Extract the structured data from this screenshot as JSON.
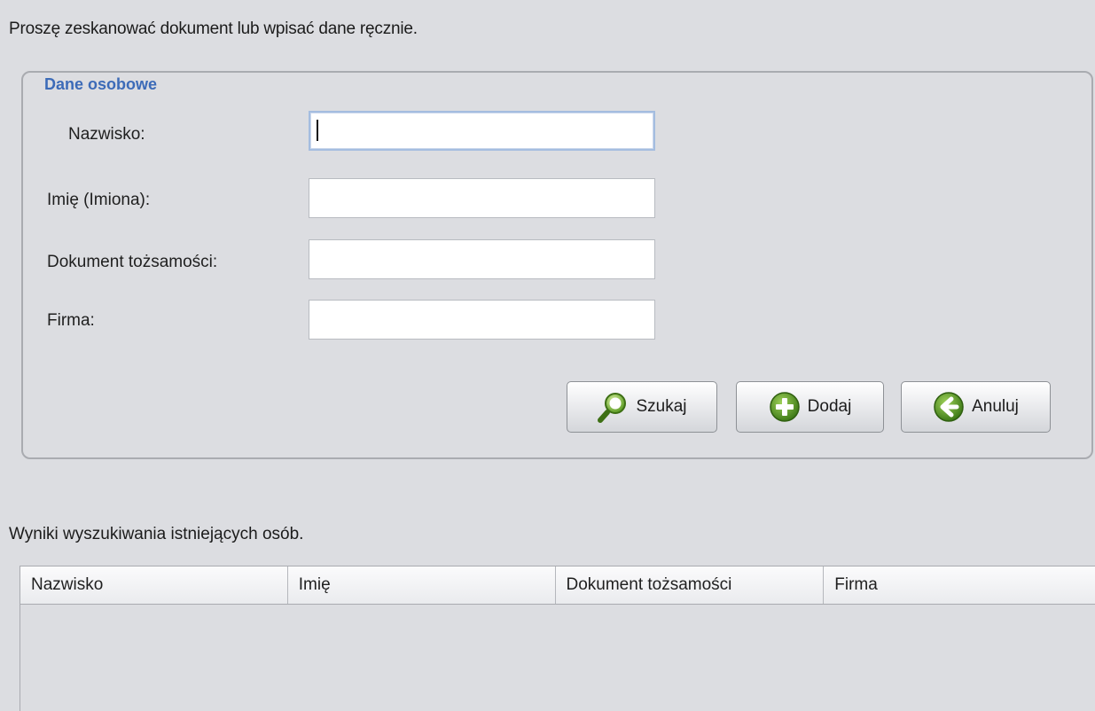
{
  "instruction": "Proszę zeskanować dokument lub wpisać dane ręcznie.",
  "group": {
    "title": "Dane osobowe"
  },
  "fields": {
    "surname_label": "Nazwisko:",
    "surname_value": "",
    "firstname_label": "Imię (Imiona):",
    "firstname_value": "",
    "document_label": "Dokument tożsamości:",
    "document_value": "",
    "company_label": "Firma:",
    "company_value": ""
  },
  "buttons": {
    "search": {
      "label": "Szukaj",
      "icon": "search-icon",
      "color": "#5a9a22"
    },
    "add": {
      "label": "Dodaj",
      "icon": "plus-circle-icon",
      "color": "#4f8e1f"
    },
    "cancel": {
      "label": "Anuluj",
      "icon": "arrow-left-circle-icon",
      "color": "#4f8e1f"
    }
  },
  "results": {
    "label": "Wyniki wyszukiwania istniejących osób.",
    "columns": [
      "Nazwisko",
      "Imię",
      "Dokument tożsamości",
      "Firma"
    ],
    "rows": []
  }
}
